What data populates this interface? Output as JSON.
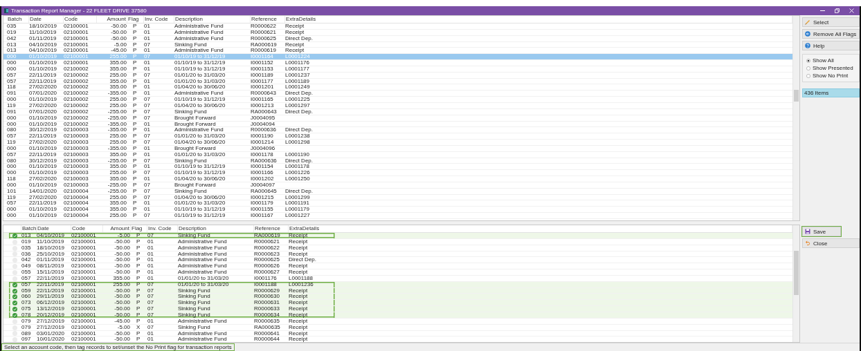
{
  "window": {
    "title": "Transaction Report Manager - 22 FLEET DRIVE 37580"
  },
  "top_table": {
    "columns": [
      {
        "label": "Batch",
        "sorted": false
      },
      {
        "label": "Date",
        "sorted": false
      },
      {
        "label": "Code",
        "sorted": true
      },
      {
        "label": "Amount",
        "sorted": false
      },
      {
        "label": "Flag",
        "sorted": false
      },
      {
        "label": "Inv. Code",
        "sorted": false
      },
      {
        "label": "Description",
        "sorted": false
      },
      {
        "label": "Reference",
        "sorted": false
      },
      {
        "label": "ExtraDetails",
        "sorted": false
      }
    ],
    "rows": [
      {
        "selected": false,
        "cells": [
          "035",
          "18/10/2019",
          "02100001",
          "-50.00",
          "P",
          "01",
          "Administrative Fund",
          "R0000622",
          "Receipt"
        ]
      },
      {
        "selected": false,
        "cells": [
          "019",
          "11/10/2019",
          "02100001",
          "-50.00",
          "P",
          "01",
          "Administrative Fund",
          "R0000621",
          "Receipt"
        ]
      },
      {
        "selected": false,
        "cells": [
          "042",
          "01/11/2019",
          "02100001",
          "-50.00",
          "P",
          "01",
          "Administrative Fund",
          "R0000625",
          "Direct Dep."
        ]
      },
      {
        "selected": false,
        "cells": [
          "013",
          "04/10/2019",
          "02100001",
          "-5.00",
          "P",
          "07",
          "Sinking Fund",
          "RA000619",
          "Receipt"
        ]
      },
      {
        "selected": false,
        "cells": [
          "013",
          "04/10/2019",
          "02100001",
          "-45.00",
          "P",
          "01",
          "Administrative Fund",
          "R0000619",
          "Receipt"
        ]
      },
      {
        "selected": true,
        "cells": [
          "000",
          "01/10/2019",
          "02100001",
          "255.00",
          "P",
          "07",
          "01/10/19 to 31/12/19",
          "I0001164",
          "L0001224"
        ]
      },
      {
        "selected": false,
        "cells": [
          "000",
          "01/10/2019",
          "02100001",
          "355.00",
          "P",
          "01",
          "01/10/19 to 31/12/19",
          "I0001152",
          "L0001176"
        ]
      },
      {
        "selected": false,
        "cells": [
          "000",
          "01/10/2019",
          "02100002",
          "355.00",
          "P",
          "01",
          "01/10/19 to 31/12/19",
          "I0001153",
          "L0001177"
        ]
      },
      {
        "selected": false,
        "cells": [
          "057",
          "22/11/2019",
          "02100002",
          "255.00",
          "P",
          "07",
          "01/01/20 to 31/03/20",
          "I0001189",
          "L0001237"
        ]
      },
      {
        "selected": false,
        "cells": [
          "057",
          "22/11/2019",
          "02100002",
          "355.00",
          "P",
          "01",
          "01/01/20 to 31/03/20",
          "I0001177",
          "L0001189"
        ]
      },
      {
        "selected": false,
        "cells": [
          "118",
          "27/02/2020",
          "02100002",
          "355.00",
          "P",
          "01",
          "01/04/20 to 30/06/20",
          "I0001201",
          "L0001249"
        ]
      },
      {
        "selected": false,
        "cells": [
          "091",
          "07/01/2020",
          "02100002",
          "-355.00",
          "P",
          "01",
          "Administrative Fund",
          "R0000643",
          "Direct Dep."
        ]
      },
      {
        "selected": false,
        "cells": [
          "000",
          "01/10/2019",
          "02100002",
          "255.00",
          "P",
          "07",
          "01/10/19 to 31/12/19",
          "I0001165",
          "L0001225"
        ]
      },
      {
        "selected": false,
        "cells": [
          "119",
          "27/02/2020",
          "02100002",
          "255.00",
          "P",
          "07",
          "01/04/20 to 30/06/20",
          "I0001213",
          "L0001297"
        ]
      },
      {
        "selected": false,
        "cells": [
          "091",
          "07/01/2020",
          "02100002",
          "-255.00",
          "P",
          "07",
          "Sinking Fund",
          "RA000643",
          "Direct Dep."
        ]
      },
      {
        "selected": false,
        "cells": [
          "000",
          "01/10/2019",
          "02100002",
          "-255.00",
          "P",
          "07",
          "Brought Forward",
          "J0004095"
        ]
      },
      {
        "selected": false,
        "cells": [
          "000",
          "01/10/2019",
          "02100002",
          "-355.00",
          "P",
          "01",
          "Brought Forward",
          "J0004094"
        ]
      },
      {
        "selected": false,
        "cells": [
          "080",
          "30/12/2019",
          "02100003",
          "-355.00",
          "P",
          "01",
          "Administrative Fund",
          "R0000636",
          "Direct Dep."
        ]
      },
      {
        "selected": false,
        "cells": [
          "057",
          "22/11/2019",
          "02100003",
          "255.00",
          "P",
          "07",
          "01/01/20 to 31/03/20",
          "I0001190",
          "L0001238"
        ]
      },
      {
        "selected": false,
        "cells": [
          "119",
          "27/02/2020",
          "02100003",
          "255.00",
          "P",
          "07",
          "01/04/20 to 30/06/20",
          "I0001214",
          "L0001298"
        ]
      },
      {
        "selected": false,
        "cells": [
          "000",
          "01/10/2019",
          "02100003",
          "-355.00",
          "P",
          "01",
          "Brought Forward",
          "J0004096"
        ]
      },
      {
        "selected": false,
        "cells": [
          "057",
          "22/11/2019",
          "02100003",
          "355.00",
          "P",
          "01",
          "01/01/20 to 31/03/20",
          "I0001178",
          "L0001190"
        ]
      },
      {
        "selected": false,
        "cells": [
          "080",
          "30/12/2019",
          "02100003",
          "-255.00",
          "P",
          "07",
          "Sinking Fund",
          "RA000636",
          "Direct Dep."
        ]
      },
      {
        "selected": false,
        "cells": [
          "000",
          "01/10/2019",
          "02100003",
          "355.00",
          "P",
          "01",
          "01/10/19 to 31/12/19",
          "I0001154",
          "L0001178"
        ]
      },
      {
        "selected": false,
        "cells": [
          "000",
          "01/10/2019",
          "02100003",
          "255.00",
          "P",
          "07",
          "01/10/19 to 31/12/19",
          "I0001166",
          "L0001226"
        ]
      },
      {
        "selected": false,
        "cells": [
          "118",
          "27/02/2020",
          "02100003",
          "355.00",
          "P",
          "01",
          "01/04/20 to 30/06/20",
          "I0001202",
          "L0001250"
        ]
      },
      {
        "selected": false,
        "cells": [
          "000",
          "01/10/2019",
          "02100003",
          "-255.00",
          "P",
          "07",
          "Brought Forward",
          "J0004097"
        ]
      },
      {
        "selected": false,
        "cells": [
          "101",
          "14/01/2020",
          "02100004",
          "-255.00",
          "P",
          "07",
          "Sinking Fund",
          "RA000645",
          "Direct Dep."
        ]
      },
      {
        "selected": false,
        "cells": [
          "119",
          "27/02/2020",
          "02100004",
          "255.00",
          "P",
          "07",
          "01/04/20 to 30/06/20",
          "I0001215",
          "L0001299"
        ]
      },
      {
        "selected": false,
        "cells": [
          "057",
          "22/11/2019",
          "02100004",
          "355.00",
          "P",
          "01",
          "01/01/20 to 31/03/20",
          "I0001179",
          "L0001191"
        ]
      },
      {
        "selected": false,
        "cells": [
          "000",
          "01/10/2019",
          "02100004",
          "355.00",
          "P",
          "01",
          "01/10/19 to 31/12/19",
          "I0001155",
          "L0001179"
        ]
      },
      {
        "selected": false,
        "cells": [
          "000",
          "01/10/2019",
          "02100004",
          "255.00",
          "P",
          "07",
          "01/10/19 to 31/12/19",
          "I0001167",
          "L0001227"
        ]
      }
    ]
  },
  "bottom_table": {
    "columns": [
      "Batch",
      "Date",
      "Code",
      "Amount",
      "Flag",
      "Inv. Code",
      "Description",
      "Reference",
      "ExtraDetails"
    ],
    "rows": [
      {
        "tagged": true,
        "highlighted": true,
        "cells": [
          "013",
          "04/10/2019",
          "02100001",
          "-5.00",
          "P",
          "07",
          "Sinking Fund",
          "RA000619",
          "Receipt"
        ]
      },
      {
        "tagged": false,
        "highlighted": false,
        "cells": [
          "019",
          "11/10/2019",
          "02100001",
          "-50.00",
          "P",
          "01",
          "Administrative Fund",
          "R0000621",
          "Receipt"
        ]
      },
      {
        "tagged": false,
        "highlighted": false,
        "cells": [
          "035",
          "18/10/2019",
          "02100001",
          "-50.00",
          "P",
          "01",
          "Administrative Fund",
          "R0000622",
          "Receipt"
        ]
      },
      {
        "tagged": false,
        "highlighted": false,
        "cells": [
          "036",
          "25/10/2019",
          "02100001",
          "-50.00",
          "P",
          "01",
          "Administrative Fund",
          "R0000623",
          "Receipt"
        ]
      },
      {
        "tagged": false,
        "highlighted": false,
        "cells": [
          "042",
          "01/11/2019",
          "02100001",
          "-50.00",
          "P",
          "01",
          "Administrative Fund",
          "R0000625",
          "Direct Dep."
        ]
      },
      {
        "tagged": false,
        "highlighted": false,
        "cells": [
          "049",
          "08/11/2019",
          "02100001",
          "-50.00",
          "P",
          "01",
          "Administrative Fund",
          "R0000626",
          "Receipt"
        ]
      },
      {
        "tagged": false,
        "highlighted": false,
        "cells": [
          "055",
          "15/11/2019",
          "02100001",
          "-50.00",
          "P",
          "01",
          "Administrative Fund",
          "R0000627",
          "Receipt"
        ]
      },
      {
        "tagged": false,
        "highlighted": false,
        "cells": [
          "057",
          "22/11/2019",
          "02100001",
          "355.00",
          "P",
          "01",
          "01/01/20 to 31/03/20",
          "I0001176",
          "L0001188"
        ]
      },
      {
        "tagged": true,
        "highlighted": true,
        "cells": [
          "057",
          "22/11/2019",
          "02100001",
          "255.00",
          "P",
          "07",
          "01/01/20 to 31/03/20",
          "I0001188",
          "L0001236"
        ]
      },
      {
        "tagged": true,
        "highlighted": true,
        "cells": [
          "059",
          "22/11/2019",
          "02100001",
          "-50.00",
          "P",
          "07",
          "Sinking Fund",
          "R0000629",
          "Receipt"
        ]
      },
      {
        "tagged": true,
        "highlighted": true,
        "cells": [
          "060",
          "29/11/2019",
          "02100001",
          "-50.00",
          "P",
          "07",
          "Sinking Fund",
          "R0000630",
          "Receipt"
        ]
      },
      {
        "tagged": true,
        "highlighted": true,
        "cells": [
          "073",
          "06/12/2019",
          "02100001",
          "-50.00",
          "P",
          "07",
          "Sinking Fund",
          "R0000631",
          "Receipt"
        ]
      },
      {
        "tagged": true,
        "highlighted": true,
        "cells": [
          "075",
          "13/12/2019",
          "02100001",
          "-50.00",
          "P",
          "07",
          "Sinking Fund",
          "R0000633",
          "Receipt"
        ]
      },
      {
        "tagged": true,
        "highlighted": true,
        "cells": [
          "078",
          "20/12/2019",
          "02100001",
          "-50.00",
          "P",
          "07",
          "Sinking Fund",
          "R0000634",
          "Receipt"
        ]
      },
      {
        "tagged": false,
        "highlighted": false,
        "cells": [
          "079",
          "27/12/2019",
          "02100001",
          "-45.00",
          "P",
          "01",
          "Administrative Fund",
          "R0000635",
          "Receipt"
        ]
      },
      {
        "tagged": false,
        "highlighted": false,
        "cells": [
          "079",
          "27/12/2019",
          "02100001",
          "-5.00",
          "X",
          "07",
          "Sinking Fund",
          "RA000635",
          "Receipt"
        ]
      },
      {
        "tagged": false,
        "highlighted": false,
        "cells": [
          "089",
          "03/01/2020",
          "02100001",
          "-50.00",
          "P",
          "01",
          "Administrative Fund",
          "R0000641",
          "Receipt"
        ]
      },
      {
        "tagged": false,
        "highlighted": false,
        "cells": [
          "097",
          "10/01/2020",
          "02100001",
          "-50.00",
          "P",
          "01",
          "Administrative Fund",
          "R0000644",
          "Receipt"
        ]
      }
    ]
  },
  "side_panel": {
    "buttons": [
      {
        "label": "Select",
        "kind": "select"
      },
      {
        "label": "Remove All Flags",
        "kind": "remove"
      },
      {
        "label": "Help",
        "kind": "help"
      }
    ],
    "filters": [
      {
        "label": "Show All",
        "selected": true
      },
      {
        "label": "Show Presented",
        "selected": false
      },
      {
        "label": "Show No Print",
        "selected": false
      }
    ],
    "item_count": "436 Items",
    "bottom_buttons": [
      {
        "label": "Save",
        "kind": "save",
        "highlighted": true
      },
      {
        "label": "Close",
        "kind": "close",
        "highlighted": false
      }
    ]
  },
  "status_bar": {
    "text": "Select an account code, then tag records to set/unset the No Print flag for transaction reports",
    "highlighted": true
  }
}
